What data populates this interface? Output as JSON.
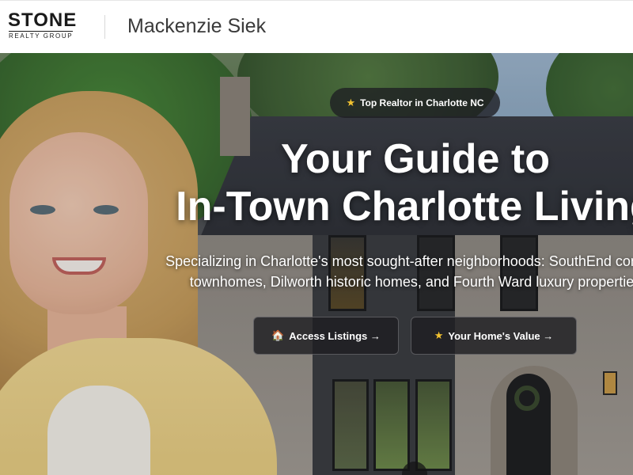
{
  "header": {
    "logo_main": "STONE",
    "logo_sub": "REALTY GROUP",
    "agent_name": "Mackenzie Siek"
  },
  "hero": {
    "badge_icon": "star-icon",
    "badge_text": "Top Realtor in Charlotte NC",
    "headline_line1": "Your Guide to",
    "headline_line2": "In-Town Charlotte Living",
    "subtext_line1": "Specializing in Charlotte's most sought-after neighborhoods: SouthEnd condos,",
    "subtext_line2": "townhomes, Dilworth historic homes, and Fourth Ward luxury properties",
    "buttons": [
      {
        "icon": "house-icon",
        "glyph": "🏠",
        "label": "Access Listings →"
      },
      {
        "icon": "star-icon",
        "glyph": "★",
        "label": "Your Home's Value →"
      }
    ]
  },
  "colors": {
    "accent_star": "#f2c230",
    "dark_pill": "#1e1e22",
    "header_bg": "#ffffff"
  }
}
